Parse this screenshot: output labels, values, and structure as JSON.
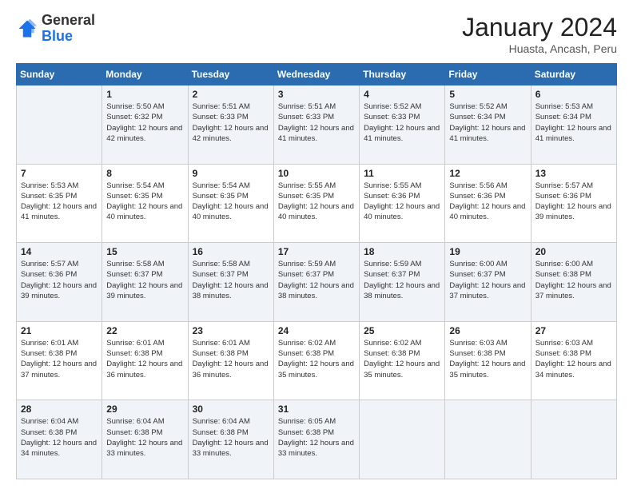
{
  "header": {
    "logo_general": "General",
    "logo_blue": "Blue",
    "main_title": "January 2024",
    "subtitle": "Huasta, Ancash, Peru"
  },
  "calendar": {
    "days_of_week": [
      "Sunday",
      "Monday",
      "Tuesday",
      "Wednesday",
      "Thursday",
      "Friday",
      "Saturday"
    ],
    "weeks": [
      [
        {
          "day": "",
          "sunrise": "",
          "sunset": "",
          "daylight": ""
        },
        {
          "day": "1",
          "sunrise": "Sunrise: 5:50 AM",
          "sunset": "Sunset: 6:32 PM",
          "daylight": "Daylight: 12 hours and 42 minutes."
        },
        {
          "day": "2",
          "sunrise": "Sunrise: 5:51 AM",
          "sunset": "Sunset: 6:33 PM",
          "daylight": "Daylight: 12 hours and 42 minutes."
        },
        {
          "day": "3",
          "sunrise": "Sunrise: 5:51 AM",
          "sunset": "Sunset: 6:33 PM",
          "daylight": "Daylight: 12 hours and 41 minutes."
        },
        {
          "day": "4",
          "sunrise": "Sunrise: 5:52 AM",
          "sunset": "Sunset: 6:33 PM",
          "daylight": "Daylight: 12 hours and 41 minutes."
        },
        {
          "day": "5",
          "sunrise": "Sunrise: 5:52 AM",
          "sunset": "Sunset: 6:34 PM",
          "daylight": "Daylight: 12 hours and 41 minutes."
        },
        {
          "day": "6",
          "sunrise": "Sunrise: 5:53 AM",
          "sunset": "Sunset: 6:34 PM",
          "daylight": "Daylight: 12 hours and 41 minutes."
        }
      ],
      [
        {
          "day": "7",
          "sunrise": "Sunrise: 5:53 AM",
          "sunset": "Sunset: 6:35 PM",
          "daylight": "Daylight: 12 hours and 41 minutes."
        },
        {
          "day": "8",
          "sunrise": "Sunrise: 5:54 AM",
          "sunset": "Sunset: 6:35 PM",
          "daylight": "Daylight: 12 hours and 40 minutes."
        },
        {
          "day": "9",
          "sunrise": "Sunrise: 5:54 AM",
          "sunset": "Sunset: 6:35 PM",
          "daylight": "Daylight: 12 hours and 40 minutes."
        },
        {
          "day": "10",
          "sunrise": "Sunrise: 5:55 AM",
          "sunset": "Sunset: 6:35 PM",
          "daylight": "Daylight: 12 hours and 40 minutes."
        },
        {
          "day": "11",
          "sunrise": "Sunrise: 5:55 AM",
          "sunset": "Sunset: 6:36 PM",
          "daylight": "Daylight: 12 hours and 40 minutes."
        },
        {
          "day": "12",
          "sunrise": "Sunrise: 5:56 AM",
          "sunset": "Sunset: 6:36 PM",
          "daylight": "Daylight: 12 hours and 40 minutes."
        },
        {
          "day": "13",
          "sunrise": "Sunrise: 5:57 AM",
          "sunset": "Sunset: 6:36 PM",
          "daylight": "Daylight: 12 hours and 39 minutes."
        }
      ],
      [
        {
          "day": "14",
          "sunrise": "Sunrise: 5:57 AM",
          "sunset": "Sunset: 6:36 PM",
          "daylight": "Daylight: 12 hours and 39 minutes."
        },
        {
          "day": "15",
          "sunrise": "Sunrise: 5:58 AM",
          "sunset": "Sunset: 6:37 PM",
          "daylight": "Daylight: 12 hours and 39 minutes."
        },
        {
          "day": "16",
          "sunrise": "Sunrise: 5:58 AM",
          "sunset": "Sunset: 6:37 PM",
          "daylight": "Daylight: 12 hours and 38 minutes."
        },
        {
          "day": "17",
          "sunrise": "Sunrise: 5:59 AM",
          "sunset": "Sunset: 6:37 PM",
          "daylight": "Daylight: 12 hours and 38 minutes."
        },
        {
          "day": "18",
          "sunrise": "Sunrise: 5:59 AM",
          "sunset": "Sunset: 6:37 PM",
          "daylight": "Daylight: 12 hours and 38 minutes."
        },
        {
          "day": "19",
          "sunrise": "Sunrise: 6:00 AM",
          "sunset": "Sunset: 6:37 PM",
          "daylight": "Daylight: 12 hours and 37 minutes."
        },
        {
          "day": "20",
          "sunrise": "Sunrise: 6:00 AM",
          "sunset": "Sunset: 6:38 PM",
          "daylight": "Daylight: 12 hours and 37 minutes."
        }
      ],
      [
        {
          "day": "21",
          "sunrise": "Sunrise: 6:01 AM",
          "sunset": "Sunset: 6:38 PM",
          "daylight": "Daylight: 12 hours and 37 minutes."
        },
        {
          "day": "22",
          "sunrise": "Sunrise: 6:01 AM",
          "sunset": "Sunset: 6:38 PM",
          "daylight": "Daylight: 12 hours and 36 minutes."
        },
        {
          "day": "23",
          "sunrise": "Sunrise: 6:01 AM",
          "sunset": "Sunset: 6:38 PM",
          "daylight": "Daylight: 12 hours and 36 minutes."
        },
        {
          "day": "24",
          "sunrise": "Sunrise: 6:02 AM",
          "sunset": "Sunset: 6:38 PM",
          "daylight": "Daylight: 12 hours and 35 minutes."
        },
        {
          "day": "25",
          "sunrise": "Sunrise: 6:02 AM",
          "sunset": "Sunset: 6:38 PM",
          "daylight": "Daylight: 12 hours and 35 minutes."
        },
        {
          "day": "26",
          "sunrise": "Sunrise: 6:03 AM",
          "sunset": "Sunset: 6:38 PM",
          "daylight": "Daylight: 12 hours and 35 minutes."
        },
        {
          "day": "27",
          "sunrise": "Sunrise: 6:03 AM",
          "sunset": "Sunset: 6:38 PM",
          "daylight": "Daylight: 12 hours and 34 minutes."
        }
      ],
      [
        {
          "day": "28",
          "sunrise": "Sunrise: 6:04 AM",
          "sunset": "Sunset: 6:38 PM",
          "daylight": "Daylight: 12 hours and 34 minutes."
        },
        {
          "day": "29",
          "sunrise": "Sunrise: 6:04 AM",
          "sunset": "Sunset: 6:38 PM",
          "daylight": "Daylight: 12 hours and 33 minutes."
        },
        {
          "day": "30",
          "sunrise": "Sunrise: 6:04 AM",
          "sunset": "Sunset: 6:38 PM",
          "daylight": "Daylight: 12 hours and 33 minutes."
        },
        {
          "day": "31",
          "sunrise": "Sunrise: 6:05 AM",
          "sunset": "Sunset: 6:38 PM",
          "daylight": "Daylight: 12 hours and 33 minutes."
        },
        {
          "day": "",
          "sunrise": "",
          "sunset": "",
          "daylight": ""
        },
        {
          "day": "",
          "sunrise": "",
          "sunset": "",
          "daylight": ""
        },
        {
          "day": "",
          "sunrise": "",
          "sunset": "",
          "daylight": ""
        }
      ]
    ]
  }
}
